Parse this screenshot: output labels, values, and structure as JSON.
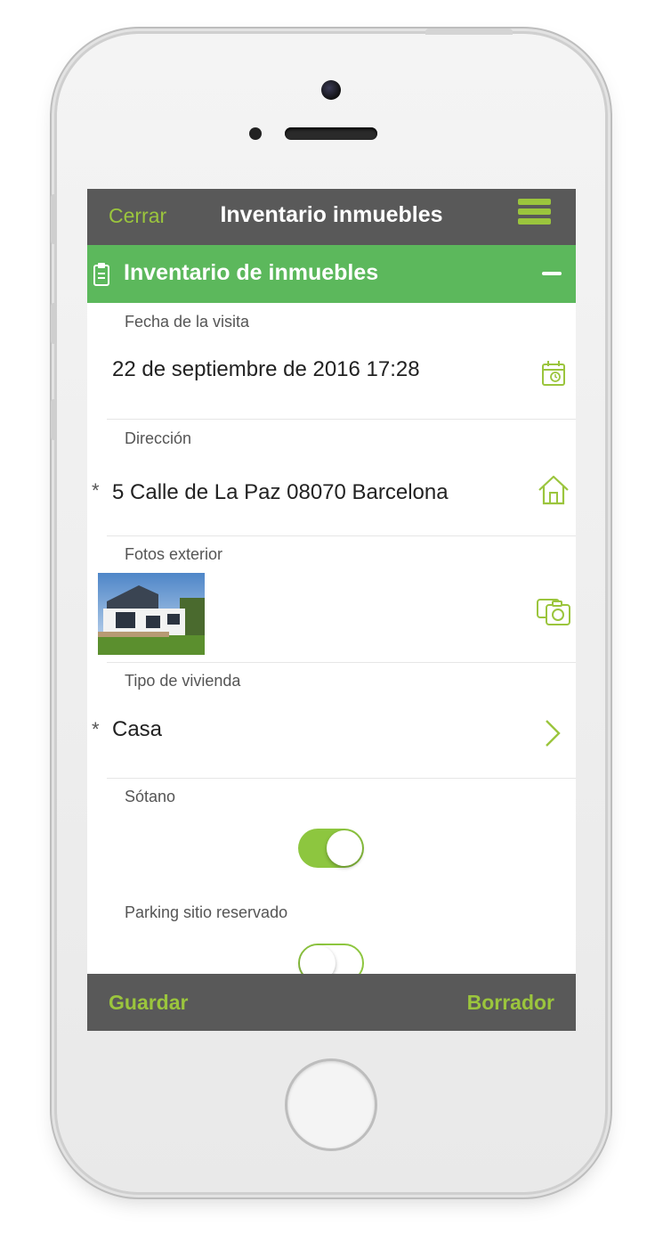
{
  "navbar": {
    "close_label": "Cerrar",
    "title": "Inventario inmuebles"
  },
  "section": {
    "title": "Inventario de inmuebles"
  },
  "fields": {
    "visit_date": {
      "label": "Fecha de la visita",
      "value": "22 de septiembre de 2016 17:28"
    },
    "address": {
      "label": "Dirección",
      "value": "5 Calle de La Paz 08070 Barcelona",
      "required_mark": "*"
    },
    "exterior_photos": {
      "label": "Fotos exterior"
    },
    "dwelling_type": {
      "label": "Tipo de vivienda",
      "value": "Casa",
      "required_mark": "*"
    },
    "basement": {
      "label": "Sótano",
      "checked": true
    },
    "parking": {
      "label": "Parking sitio reservado",
      "checked": false
    }
  },
  "toolbar": {
    "save_label": "Guardar",
    "draft_label": "Borrador"
  },
  "colors": {
    "accent": "#9bc53d",
    "section": "#5cb85c",
    "bar": "#595959"
  }
}
